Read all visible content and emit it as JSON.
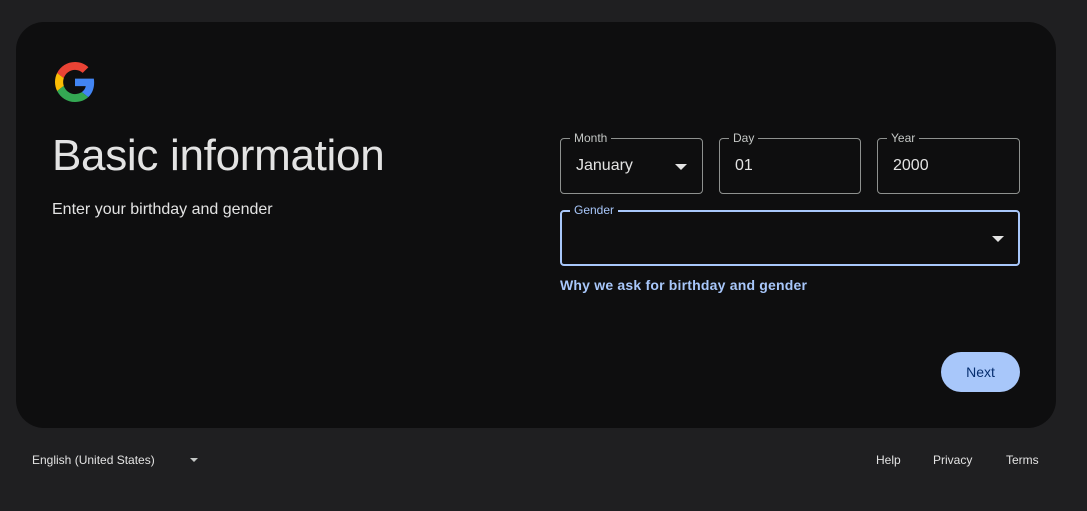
{
  "header": {
    "title": "Basic information",
    "subtitle": "Enter your birthday and gender"
  },
  "form": {
    "month": {
      "label": "Month",
      "value": "January"
    },
    "day": {
      "label": "Day",
      "value": "01"
    },
    "year": {
      "label": "Year",
      "value": "2000"
    },
    "gender": {
      "label": "Gender",
      "value": ""
    },
    "why_link": "Why we ask for birthday and gender",
    "next_label": "Next"
  },
  "footer": {
    "language": "English (United States)",
    "links": [
      "Help",
      "Privacy",
      "Terms"
    ]
  },
  "colors": {
    "page_background": "#1f1f21",
    "card_background": "#0e0e0f",
    "accent": "#a8c7fa",
    "button_text": "#062e6f"
  },
  "icons": {
    "logo": "google-g-logo",
    "dropdown": "caret-down-icon"
  }
}
